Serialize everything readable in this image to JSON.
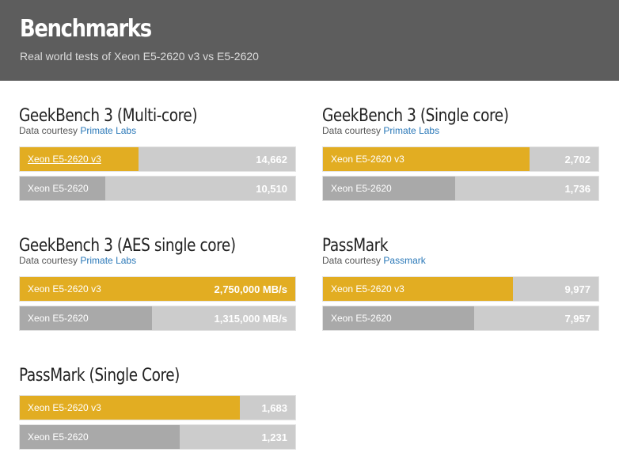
{
  "header": {
    "title": "Benchmarks",
    "subtitle": "Real world tests of Xeon E5-2620 v3 vs E5-2620"
  },
  "colors": {
    "header_bg": "#5d5d5d",
    "primary_bar": "#e2ad22",
    "secondary_bar": "#a9a9a9",
    "track": "#cccccc",
    "link": "#2a78b8"
  },
  "benchmarks": [
    {
      "title": "GeekBench 3 (Multi-core)",
      "credit_prefix": "Data courtesy",
      "credit_link": "Primate Labs",
      "rows": [
        {
          "name": "Xeon E5-2620 v3",
          "score": "14,662",
          "value": 14662
        },
        {
          "name": "Xeon E5-2620",
          "score": "10,510",
          "value": 10510
        }
      ]
    },
    {
      "title": "GeekBench 3 (Single core)",
      "credit_prefix": "Data courtesy",
      "credit_link": "Primate Labs",
      "rows": [
        {
          "name": "Xeon E5-2620 v3",
          "score": "2,702",
          "value": 2702
        },
        {
          "name": "Xeon E5-2620",
          "score": "1,736",
          "value": 1736
        }
      ]
    },
    {
      "title": "GeekBench 3 (AES single core)",
      "credit_prefix": "Data courtesy",
      "credit_link": "Primate Labs",
      "rows": [
        {
          "name": "Xeon E5-2620 v3",
          "score": "2,750,000 MB/s",
          "value": 2750000
        },
        {
          "name": "Xeon E5-2620",
          "score": "1,315,000 MB/s",
          "value": 1315000
        }
      ]
    },
    {
      "title": "PassMark",
      "credit_prefix": "Data courtesy",
      "credit_link": "Passmark",
      "rows": [
        {
          "name": "Xeon E5-2620 v3",
          "score": "9,977",
          "value": 9977
        },
        {
          "name": "Xeon E5-2620",
          "score": "7,957",
          "value": 7957
        }
      ]
    },
    {
      "title": "PassMark (Single Core)",
      "rows": [
        {
          "name": "Xeon E5-2620 v3",
          "score": "1,683",
          "value": 1683
        },
        {
          "name": "Xeon E5-2620",
          "score": "1,231",
          "value": 1231
        }
      ]
    }
  ],
  "bar_fill_fraction": [
    [
      0.43,
      0.31
    ],
    [
      0.75,
      0.48
    ],
    [
      1.0,
      0.48
    ],
    [
      0.69,
      0.55
    ],
    [
      0.8,
      0.58
    ]
  ]
}
